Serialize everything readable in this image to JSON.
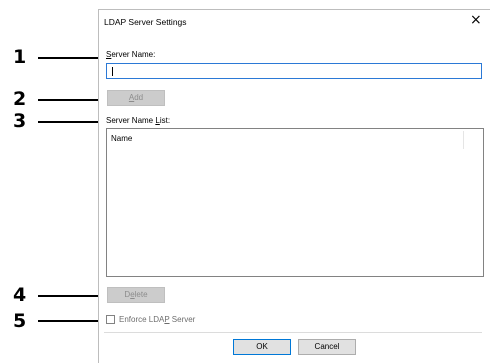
{
  "dialog": {
    "title": "LDAP Server Settings",
    "close_glyph": "×"
  },
  "callouts": [
    "1",
    "2",
    "3",
    "4",
    "5"
  ],
  "server_name": {
    "label_mnemonic": "S",
    "label_rest": "erver Name:",
    "value": ""
  },
  "add_button": {
    "mnemonic": "A",
    "rest": "dd"
  },
  "list": {
    "label_pre": "Server Name ",
    "label_mnemonic": "L",
    "label_post": "ist:",
    "column_header": "Name"
  },
  "delete_button": {
    "pre": "D",
    "mnemonic": "e",
    "post": "lete"
  },
  "enforce": {
    "pre": "Enforce LDA",
    "mnemonic": "P",
    "post": " Server",
    "checked": false
  },
  "footer": {
    "ok_label": "OK",
    "cancel_label": "Cancel"
  },
  "colors": {
    "focus_border": "#2b79d6",
    "disabled_button": "#cccccc",
    "default_button_border": "#0078d7"
  }
}
